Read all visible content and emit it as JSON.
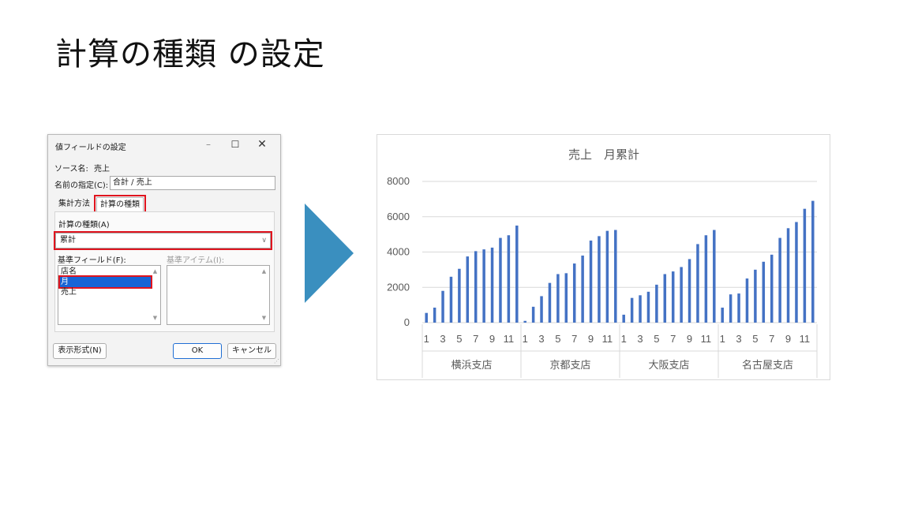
{
  "slide": {
    "title": "計算の種類 の設定"
  },
  "dialog": {
    "title": "値フィールドの設定",
    "window_controls": {
      "minimize": "–",
      "maximize": "☐",
      "close": "✕"
    },
    "source_label": "ソース名:",
    "source_value": "売上",
    "name_label": "名前の指定(C):",
    "name_value": "合計 / 売上",
    "tabs": [
      {
        "label": "集計方法",
        "active": false
      },
      {
        "label": "計算の種類",
        "active": true
      }
    ],
    "calc_type_label": "計算の種類(A)",
    "calc_type_value": "累計",
    "base_field_label": "基準フィールド(F):",
    "base_field_items": [
      "店名",
      "月",
      "売上"
    ],
    "base_field_selected": "月",
    "base_item_label": "基準アイテム(I):",
    "buttons": {
      "format": "表示形式(N)",
      "ok": "OK",
      "cancel": "キャンセル"
    },
    "highlight_color": "#e0141e",
    "selection_color": "#1764d6"
  },
  "arrow": {
    "color": "#3a8fbf",
    "icon": "right-triangle-arrow"
  },
  "chart_data": {
    "type": "bar",
    "title": "売上　月累計",
    "ylim": [
      0,
      8000
    ],
    "yticks": [
      0,
      2000,
      4000,
      6000,
      8000
    ],
    "grid": true,
    "color": "#4472c4",
    "groups": [
      "横浜支店",
      "京都支店",
      "大阪支店",
      "名古屋支店"
    ],
    "month_labels": [
      "1",
      "3",
      "5",
      "7",
      "9",
      "11"
    ],
    "months": [
      1,
      2,
      3,
      4,
      5,
      6,
      7,
      8,
      9,
      10,
      11,
      12
    ],
    "series": [
      {
        "group": "横浜支店",
        "values": [
          550,
          850,
          1800,
          2600,
          3050,
          3750,
          4050,
          4150,
          4250,
          4800,
          4950,
          5500
        ]
      },
      {
        "group": "京都支店",
        "values": [
          100,
          900,
          1500,
          2250,
          2750,
          2800,
          3350,
          3800,
          4650,
          4900,
          5200,
          5250
        ]
      },
      {
        "group": "大阪支店",
        "values": [
          450,
          1400,
          1550,
          1750,
          2150,
          2750,
          2900,
          3150,
          3600,
          4450,
          4950,
          5250
        ]
      },
      {
        "group": "名古屋支店",
        "values": [
          850,
          1600,
          1650,
          2500,
          3000,
          3450,
          3850,
          4800,
          5350,
          5700,
          6450,
          6900
        ]
      }
    ]
  }
}
